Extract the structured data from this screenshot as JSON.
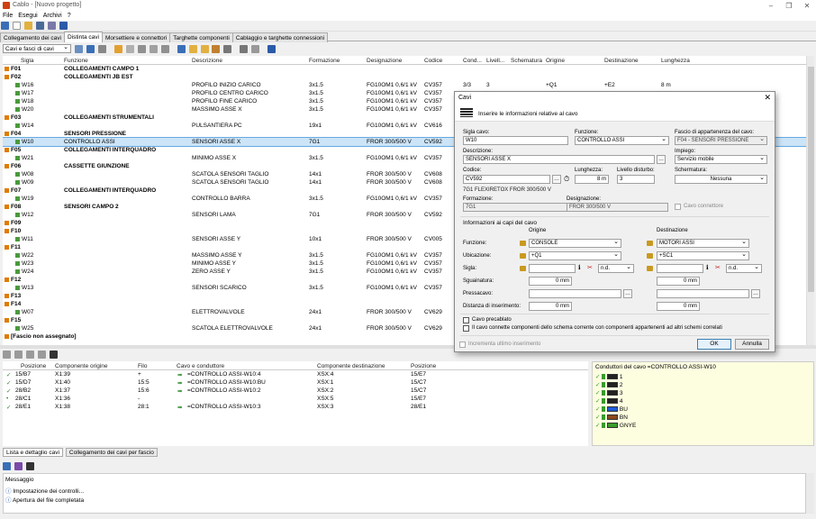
{
  "window": {
    "title": "Cablo - [Nuovo progetto]",
    "controls": [
      "–",
      "❐",
      "✕"
    ]
  },
  "menu": [
    "File",
    "Esegui",
    "Archivi",
    "?"
  ],
  "tabs": [
    "Collegamento dei cavi",
    "Distinta cavi",
    "Morsettiere e connettori",
    "Targhette componenti",
    "Cablaggio e targhette connessioni"
  ],
  "active_tab": 1,
  "filter": "Cavi e fasci di cavi",
  "table": {
    "headers": [
      "Sigla",
      "Funzione",
      "Descrizione",
      "Formazione",
      "Designazione",
      "Codice",
      "Cond...",
      "Livell...",
      "Schematura",
      "Origine",
      "Destinazione",
      "Lunghezza"
    ],
    "rows": [
      {
        "k": "f",
        "id": "F01",
        "fun": "COLLEGAMENTI CAMPO 1"
      },
      {
        "k": "f",
        "id": "F02",
        "fun": "COLLEGAMENTI JB EST"
      },
      {
        "k": "w",
        "id": "W16",
        "desc": "PROFILO INIZIO CARICO",
        "form": "3x1.5",
        "des": "FG10OM1 0,6/1 kV",
        "cod": "CV357",
        "cond": "3/3",
        "liv": "3",
        "ori": "+Q1",
        "dst": "+E2",
        "len": "8 m"
      },
      {
        "k": "w",
        "id": "W17",
        "desc": "PROFILO CENTRO CARICO",
        "form": "3x1.5",
        "des": "FG10OM1 0,6/1 kV",
        "cod": "CV357"
      },
      {
        "k": "w",
        "id": "W18",
        "desc": "PROFILO FINE CARICO",
        "form": "3x1.5",
        "des": "FG10OM1 0,6/1 kV",
        "cod": "CV357"
      },
      {
        "k": "w",
        "id": "W20",
        "desc": "MASSIMO ASSE X",
        "form": "3x1.5",
        "des": "FG10OM1 0,6/1 kV",
        "cod": "CV357"
      },
      {
        "k": "f",
        "id": "F03",
        "fun": "COLLEGAMENTI STRUMENTALI"
      },
      {
        "k": "w",
        "id": "W14",
        "desc": "PULSANTIERA PC",
        "form": "19x1",
        "des": "FG10OM1 0,6/1 kV",
        "cod": "CV616"
      },
      {
        "k": "f",
        "id": "F04",
        "fun": "SENSORI PRESSIONE"
      },
      {
        "k": "w",
        "id": "W10",
        "fun": "CONTROLLO ASSI",
        "desc": "SENSORI ASSE X",
        "form": "7G1",
        "des": "FROR 300/500 V",
        "cod": "CV592",
        "sel": true
      },
      {
        "k": "f",
        "id": "F05",
        "fun": "COLLEGAMENTI INTERQUADRO"
      },
      {
        "k": "w",
        "id": "W21",
        "desc": "MINIMO ASSE X",
        "form": "3x1.5",
        "des": "FG10OM1 0,6/1 kV",
        "cod": "CV357"
      },
      {
        "k": "f",
        "id": "F06",
        "fun": "CASSETTE GIUNZIONE"
      },
      {
        "k": "w",
        "id": "W08",
        "desc": "SCATOLA SENSORI TAGLIO",
        "form": "14x1",
        "des": "FROR 300/500 V",
        "cod": "CV608"
      },
      {
        "k": "w",
        "id": "W09",
        "desc": "SCATOLA SENSORI TAGLIO",
        "form": "14x1",
        "des": "FROR 300/500 V",
        "cod": "CV608"
      },
      {
        "k": "f",
        "id": "F07",
        "fun": "COLLEGAMENTI INTERQUADRO"
      },
      {
        "k": "w",
        "id": "W19",
        "desc": "CONTROLLO BARRA",
        "form": "3x1.5",
        "des": "FG10OM1 0,6/1 kV",
        "cod": "CV357"
      },
      {
        "k": "f",
        "id": "F08",
        "fun": "SENSORI CAMPO 2"
      },
      {
        "k": "w",
        "id": "W12",
        "desc": "SENSORI LAMA",
        "form": "7G1",
        "des": "FROR 300/500 V",
        "cod": "CV592"
      },
      {
        "k": "f",
        "id": "F09"
      },
      {
        "k": "f",
        "id": "F10"
      },
      {
        "k": "w",
        "id": "W11",
        "desc": "SENSORI ASSE Y",
        "form": "10x1",
        "des": "FROR 300/500 V",
        "cod": "CV005"
      },
      {
        "k": "f",
        "id": "F11"
      },
      {
        "k": "w",
        "id": "W22",
        "desc": "MASSIMO ASSE Y",
        "form": "3x1.5",
        "des": "FG10OM1 0,6/1 kV",
        "cod": "CV357"
      },
      {
        "k": "w",
        "id": "W23",
        "desc": "MINIMO ASSE Y",
        "form": "3x1.5",
        "des": "FG10OM1 0,6/1 kV",
        "cod": "CV357"
      },
      {
        "k": "w",
        "id": "W24",
        "desc": "ZERO ASSE Y",
        "form": "3x1.5",
        "des": "FG10OM1 0,6/1 kV",
        "cod": "CV357"
      },
      {
        "k": "f",
        "id": "F12"
      },
      {
        "k": "w",
        "id": "W13",
        "desc": "SENSORI SCARICO",
        "form": "3x1.5",
        "des": "FG10OM1 0,6/1 kV",
        "cod": "CV357"
      },
      {
        "k": "f",
        "id": "F13"
      },
      {
        "k": "f",
        "id": "F14"
      },
      {
        "k": "w",
        "id": "W07",
        "desc": "ELETTROVALVOLE",
        "form": "24x1",
        "des": "FROR 300/500 V",
        "cod": "CV629"
      },
      {
        "k": "f",
        "id": "F15"
      },
      {
        "k": "w",
        "id": "W25",
        "desc": "SCATOLA ELETTROVALVOLE",
        "form": "24x1",
        "des": "FROR 300/500 V",
        "cod": "CV629"
      },
      {
        "k": "f",
        "id": "[Fascio non assegnato]"
      }
    ]
  },
  "connections": {
    "headers": [
      "Posizione",
      "Componente origine",
      "Filo",
      "Cavo e conduttore",
      "Componente destinazione",
      "Posizione"
    ],
    "rows": [
      {
        "ok": "✓",
        "pos": "15/B7",
        "comp": "X1:39",
        "filo": "+",
        "cavo": "=CONTROLLO ASSI-W10:4",
        "dest": "XSX:4",
        "pos2": "15/E7"
      },
      {
        "ok": "✓",
        "pos": "15/D7",
        "comp": "X1:40",
        "filo": "15:5",
        "cavo": "=CONTROLLO ASSI-W10:BU",
        "dest": "XSX:1",
        "pos2": "15/C7"
      },
      {
        "ok": "✓",
        "pos": "28/B2",
        "comp": "X1:37",
        "filo": "15:6",
        "cavo": "=CONTROLLO ASSI-W10:2",
        "dest": "XSX:2",
        "pos2": "15/C7"
      },
      {
        "ok": "•",
        "pos": "28/C1",
        "comp": "X1:36",
        "filo": "-",
        "cavo": "",
        "dest": "XSX:5",
        "pos2": "15/E7"
      },
      {
        "ok": "✓",
        "pos": "28/E1",
        "comp": "X1:38",
        "filo": "28:1",
        "cavo": "=CONTROLLO ASSI-W10:3",
        "dest": "XSX:3",
        "pos2": "28/E1"
      }
    ]
  },
  "wires": {
    "title": "Conduttori del cavo =CONTROLLO ASSI-W10",
    "items": [
      {
        "n": "1",
        "c": "#222"
      },
      {
        "n": "2",
        "c": "#222"
      },
      {
        "n": "3",
        "c": "#222"
      },
      {
        "n": "4",
        "c": "#222"
      },
      {
        "n": "BU",
        "c": "#1e5bd8"
      },
      {
        "n": "BN",
        "c": "#8b4a1e"
      },
      {
        "n": "GNYE",
        "c": "#3c9c2c"
      }
    ]
  },
  "bottom_tabs": [
    "Lista e dettaglio cavi",
    "Collegamento dei cavi per fascio"
  ],
  "messages": {
    "header": "Messaggio",
    "items": [
      "Impostazione dei controlli...",
      "Apertura del file completata"
    ]
  },
  "dialog": {
    "title": "Cavi",
    "banner": "Inserire le informazioni relative al cavo",
    "sigla_label": "Sigla cavo:",
    "sigla": "W10",
    "funzione_label": "Funzione:",
    "funzione": "CONTROLLO ASSI",
    "fascio_label": "Fascio di appartenenza del cavo:",
    "fascio": "F04 - SENSORI PRESSIONE",
    "descr_label": "Descrizione:",
    "descr": "SENSORI ASSE X",
    "impiego_label": "Impiego:",
    "impiego": "Servizio mobile",
    "codice_label": "Codice:",
    "codice": "CV592",
    "lung_label": "Lunghezza:",
    "lung": "8 m",
    "livello_label": "Livello disturbo:",
    "livello": "3",
    "schem_label": "Schermatura:",
    "schem": "Nessuna",
    "codice_desc": "7G1 FLEXIRETOX FROR 300/500 V",
    "form_label": "Formazione:",
    "form": "7G1",
    "desig_label": "Designazione:",
    "desig": "FROR 300/500 V",
    "cavo_conn": "Cavo connettore",
    "capi_label": "Informazioni ai capi del cavo",
    "origine": "Origine",
    "destinazione": "Destinazione",
    "r_funzione": "Funzione:",
    "r_ubicazione": "Ubicazione:",
    "r_sigla": "Sigla:",
    "r_sguain": "Sguainatura:",
    "r_pressa": "Pressacavo:",
    "r_dist": "Distanza di inserimento:",
    "o_funz": "CONSOLE",
    "o_ubic": "+Q1",
    "o_nd": "n.d.",
    "o_sg": "0 mm",
    "o_dist": "0 mm",
    "d_funz": "MOTORI ASSI",
    "d_ubic": "+SC1",
    "d_nd": "n.d.",
    "d_sg": "0 mm",
    "d_dist": "0 mm",
    "precablato": "Cavo precablato",
    "connette": "Il cavo connette componenti dello schema corrente con componenti appartenenti ad altri schemi correlati",
    "incrementa": "Incrementa ultimo inserimento",
    "ok": "OK",
    "annulla": "Annulla"
  }
}
